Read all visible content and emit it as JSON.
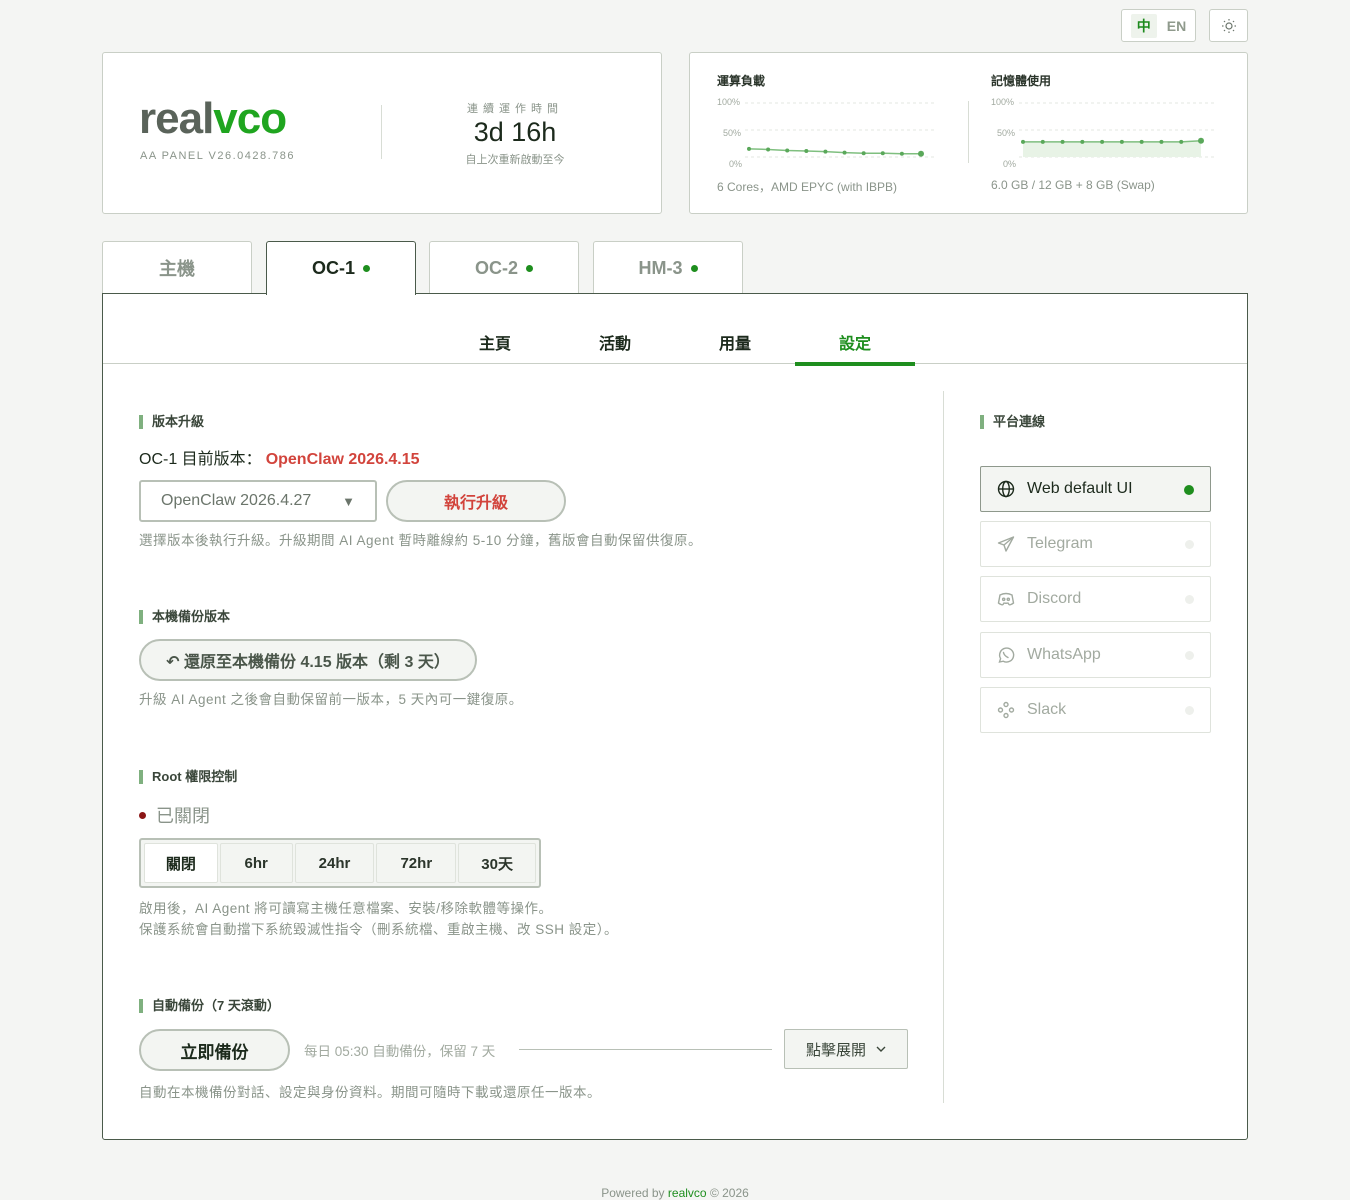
{
  "lang": {
    "zh": "中",
    "en": "EN"
  },
  "theme_icon": "sun-icon",
  "brand": {
    "logo_gray": "real",
    "logo_green": "vco",
    "version": "AA PANEL V26.0428.786",
    "uptime_label": "連續運作時間",
    "uptime_value": "3d 16h",
    "uptime_sub": "自上次重新啟動至今"
  },
  "metrics": {
    "cpu": {
      "title": "運算負載",
      "axis": [
        "100%",
        "50%",
        "0%"
      ],
      "footer": "6 Cores，AMD EPYC (with IBPB)",
      "values": [
        15,
        14,
        12,
        11,
        10,
        8,
        7,
        7,
        6,
        6
      ]
    },
    "mem": {
      "title": "記憶體使用",
      "axis": [
        "100%",
        "50%",
        "0%"
      ],
      "footer": "6.0 GB / 12 GB + 8 GB (Swap)",
      "values": [
        28,
        28,
        28,
        28,
        28,
        28,
        28,
        28,
        28,
        30
      ]
    },
    "colors": {
      "line": "#7fbf7f",
      "fill": "#e8f3e6",
      "point": "#5aa85a"
    }
  },
  "vm_tabs": [
    {
      "label": "主機",
      "status": false
    },
    {
      "label": "OC-1",
      "status": true
    },
    {
      "label": "OC-2",
      "status": true
    },
    {
      "label": "HM-3",
      "status": true
    }
  ],
  "sub_tabs": [
    "主頁",
    "活動",
    "用量",
    "設定"
  ],
  "upgrade": {
    "title": "版本升級",
    "current_prefix": "OC-1 目前版本：",
    "current_version": "OpenClaw 2026.4.15",
    "selected": "OpenClaw 2026.4.27",
    "button": "執行升級",
    "help": "選擇版本後執行升級。升級期間 AI Agent 暫時離線約 5-10 分鐘，舊版會自動保留供復原。"
  },
  "local_backup": {
    "title": "本機備份版本",
    "button": "↶ 還原至本機備份 4.15 版本（剩 3 天）",
    "help": "升級 AI Agent 之後會自動保留前一版本，5 天內可一鍵復原。"
  },
  "root": {
    "title": "Root 權限控制",
    "status": "已關閉",
    "options": [
      "關閉",
      "6hr",
      "24hr",
      "72hr",
      "30天"
    ],
    "help1": "啟用後，AI Agent 將可讀寫主機任意檔案、安裝/移除軟體等操作。",
    "help2": "保護系統會自動擋下系統毀滅性指令（刪系統檔、重啟主機、改 SSH 設定）。"
  },
  "auto_backup": {
    "title": "自動備份（7 天滾動）",
    "button": "立即備份",
    "schedule": "每日 05:30 自動備份，保留 7 天",
    "expand": "點擊展開",
    "help": "自動在本機備份對話、設定與身份資料。期間可隨時下載或還原任一版本。"
  },
  "platforms": {
    "title": "平台連線",
    "items": [
      {
        "label": "Web default UI",
        "icon": "globe-icon",
        "connected": true
      },
      {
        "label": "Telegram",
        "icon": "telegram-icon",
        "connected": false
      },
      {
        "label": "Discord",
        "icon": "discord-icon",
        "connected": false
      },
      {
        "label": "WhatsApp",
        "icon": "whatsapp-icon",
        "connected": false
      },
      {
        "label": "Slack",
        "icon": "slack-icon",
        "connected": false
      }
    ]
  },
  "footer": {
    "prefix": "Powered by",
    "brand": "realvco",
    "suffix": "© 2026"
  }
}
